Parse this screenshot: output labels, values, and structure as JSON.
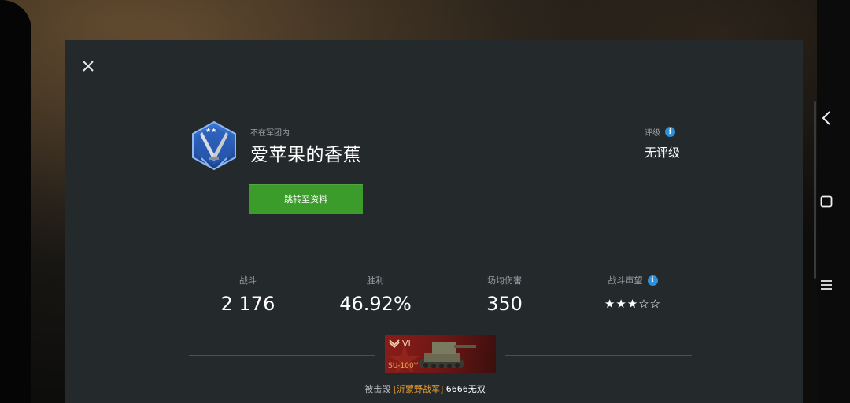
{
  "header": {
    "close_icon": "close-icon"
  },
  "player": {
    "clan_status": "不在军团内",
    "name": "爱苹果的香蕉",
    "profile_button": "跳转至资料",
    "emblem": "crossed-swords-emblem"
  },
  "rating": {
    "label": "评级",
    "value": "无评级"
  },
  "stats": [
    {
      "label": "战斗",
      "value": "2 176"
    },
    {
      "label": "胜利",
      "value": "46.92%"
    },
    {
      "label": "场均伤害",
      "value": "350"
    },
    {
      "label": "战斗声望",
      "value": "★★★☆☆",
      "filled": 3,
      "max": 5
    }
  ],
  "tank": {
    "tier": "VI",
    "name": "SU-100Y"
  },
  "destroyed": {
    "prefix": "被击毁",
    "clan_tag": "[沂蒙野战军]",
    "killer": "6666无双"
  },
  "colors": {
    "accent_green": "#3b9b2b",
    "info_blue": "#2f8fd8",
    "clan_orange": "#f0a030",
    "panel_bg": "#24292c"
  }
}
